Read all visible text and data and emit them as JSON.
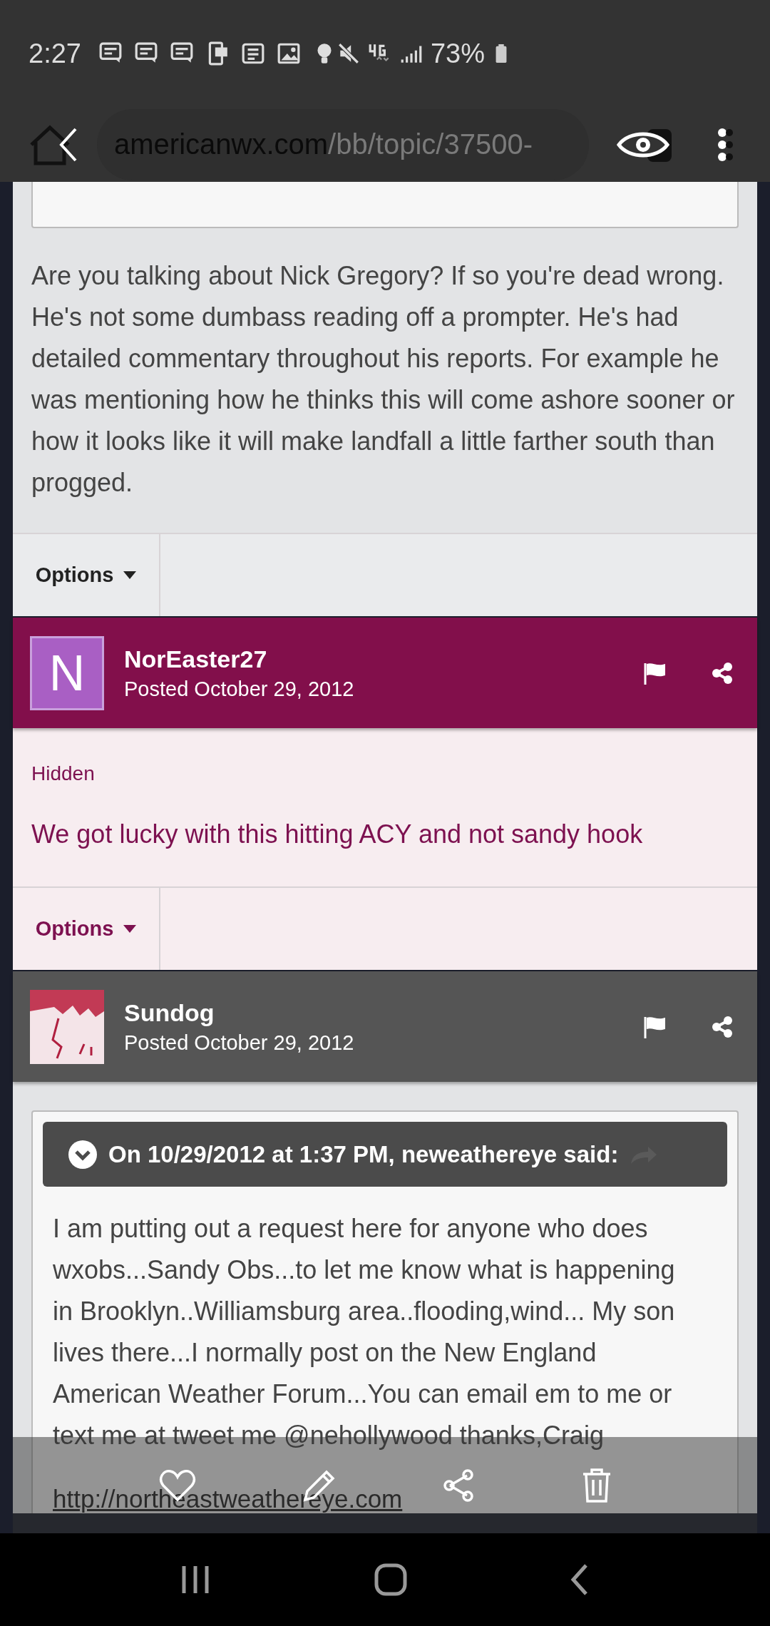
{
  "status_bar": {
    "time": "2:27",
    "battery": "73%"
  },
  "browser_bar": {
    "url_host": "americanwx.com",
    "url_path": "/bb/topic/37500-"
  },
  "posts": [
    {
      "kind": "plain",
      "body": "Are you talking about Nick Gregory? If so you're dead wrong. He's not some dumbass reading off a prompter. He's had detailed commentary throughout his reports. For example he was mentioning how he thinks this will come ashore sooner or how it looks like it will make landfall a little farther south than progged.",
      "options": "Options"
    },
    {
      "kind": "hidden",
      "author": "NorEaster27",
      "avatar_letter": "N",
      "posted": "Posted October 29, 2012",
      "status": "Hidden",
      "body": "We got lucky with this hitting ACY and not sandy hook",
      "options": "Options"
    },
    {
      "kind": "quote",
      "author": "Sundog",
      "posted": "Posted October 29, 2012",
      "quote_header": "On 10/29/2012 at 1:37 PM, neweathereye said:",
      "quote_body": "I am putting out a request here for anyone who does wxobs...Sandy Obs...to let me know what is happening in Brooklyn..Williamsburg area..flooding,wind... My son lives there...I normally post on the New England American Weather Forum...You can email em to me or text me at tweet me @nehollywood thanks,Craig",
      "quote_link": "http://northeastweathereye.com"
    }
  ]
}
